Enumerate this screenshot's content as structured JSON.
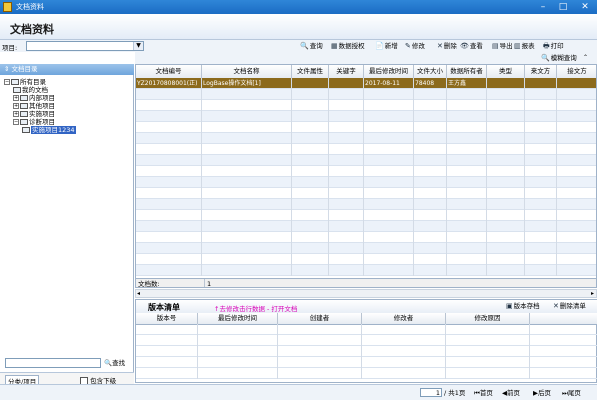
{
  "window": {
    "title": "文档资料"
  },
  "header": {
    "title": "文档资料"
  },
  "toolbar": {
    "project_label": "项目:",
    "project_value": "",
    "buttons": [
      {
        "icon": "search-icon",
        "glyph": "🔍",
        "label": "查询"
      },
      {
        "icon": "data-auth-icon",
        "glyph": "▦",
        "label": "数据授权"
      },
      {
        "icon": "new-icon",
        "glyph": "📄",
        "label": "新增"
      },
      {
        "icon": "edit-icon",
        "glyph": "✎",
        "label": "修改"
      },
      {
        "icon": "delete-icon",
        "glyph": "✕",
        "label": "删除"
      },
      {
        "icon": "view-icon",
        "glyph": "👁",
        "label": "查看"
      },
      {
        "icon": "export-icon",
        "glyph": "▤",
        "label": "导出"
      },
      {
        "icon": "report-icon",
        "glyph": "▥",
        "label": "报表"
      },
      {
        "icon": "print-icon",
        "glyph": "🖶",
        "label": "打印"
      }
    ],
    "fuzzy_search": "模糊查询"
  },
  "left": {
    "header": "文档目录",
    "tree": [
      {
        "label": "所有目录",
        "level": 0,
        "pm": "−"
      },
      {
        "label": "我的文档",
        "level": 1,
        "pm": ""
      },
      {
        "label": "内部项目",
        "level": 1,
        "pm": "+"
      },
      {
        "label": "其他项目",
        "level": 1,
        "pm": "+"
      },
      {
        "label": "实施项目",
        "level": 1,
        "pm": "+"
      },
      {
        "label": "诊断项目",
        "level": 1,
        "pm": "−"
      },
      {
        "label": "实施项目1234",
        "level": 2,
        "pm": "",
        "selected": true
      }
    ],
    "search_button": "查找",
    "tabs": "分类/项目",
    "include_sub": "包含下级"
  },
  "grid": {
    "columns": [
      "文档编号",
      "文档名称",
      "文件属性",
      "关键字",
      "最后修改时间",
      "文件大小",
      "数据所有者",
      "类型",
      "来文方",
      "接文方"
    ],
    "rows": [
      [
        "YZ20170808001(正)",
        "LogBase操作文档[1]",
        "",
        "",
        "2017-08-11",
        "78408",
        "王方鑫",
        "",
        "",
        ""
      ]
    ],
    "footer_label": "文档数:",
    "footer_value": "1"
  },
  "versions": {
    "title": "版本清单",
    "hint": "↑去修改击行数据 - 打开文档",
    "save_button": "版本存档",
    "clear_button": "删除清单",
    "columns": [
      "版本号",
      "最后修改时间",
      "创建者",
      "修改者",
      "修改原因"
    ]
  },
  "status": {
    "page_value": "1",
    "total_pages": "/ 共1页",
    "first": "首页",
    "prev": "前页",
    "next": "后页",
    "last": "尾页"
  }
}
